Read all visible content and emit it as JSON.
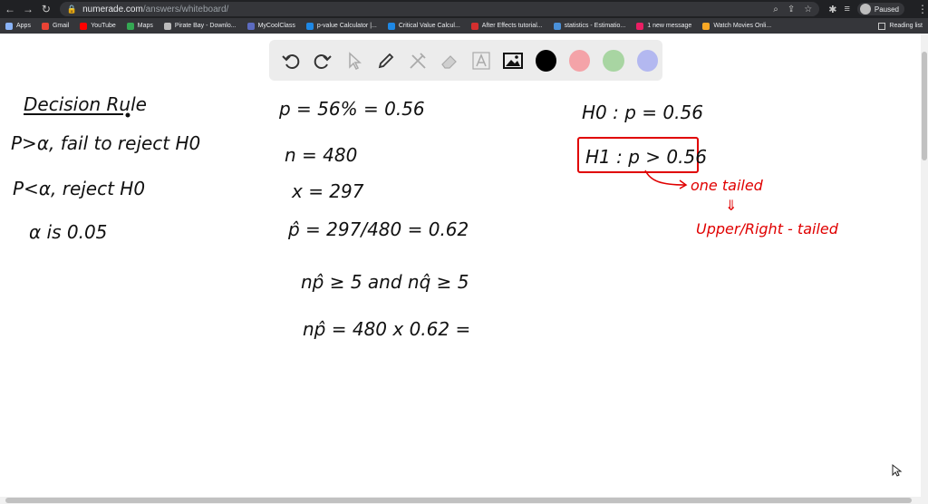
{
  "browser": {
    "url_domain": "numerade.com",
    "url_path": "/answers/whiteboard/",
    "profile_status": "Paused",
    "bookmarks": [
      {
        "label": "Apps",
        "color": "#8ab4f8"
      },
      {
        "label": "Gmail",
        "color": "#ea4335"
      },
      {
        "label": "YouTube",
        "color": "#ff0000"
      },
      {
        "label": "Maps",
        "color": "#34a853"
      },
      {
        "label": "Pirate Bay - Downlo...",
        "color": "#bbbbbb"
      },
      {
        "label": "MyCoolClass",
        "color": "#5c6bc0"
      },
      {
        "label": "p-value Calculator |...",
        "color": "#1e88e5"
      },
      {
        "label": "Critical Value Calcul...",
        "color": "#1e88e5"
      },
      {
        "label": "After Effects tutorial...",
        "color": "#d32f2f"
      },
      {
        "label": "statistics - Estimatio...",
        "color": "#4a90d9"
      },
      {
        "label": "1 new message",
        "color": "#e91e63"
      },
      {
        "label": "Watch Movies Onli...",
        "color": "#f9a825"
      }
    ],
    "reading_list": "Reading list"
  },
  "toolbar": {
    "tools": [
      "undo-icon",
      "redo-icon",
      "pointer-icon",
      "pen-icon",
      "tools-icon",
      "eraser-icon",
      "text-icon",
      "image-icon"
    ],
    "colors": [
      "#000000",
      "#f4a3a8",
      "#a8d5a2",
      "#b3b8f0"
    ]
  },
  "whiteboard": {
    "left_col": {
      "title": "Decision Rule",
      "line1": "P>α, fail to reject H0",
      "line2": "P<α, reject H0",
      "line3": "α is 0.05"
    },
    "mid_col": {
      "line1": "p = 56% = 0.56",
      "line2": "n = 480",
      "line3": "x = 297",
      "line4": "p̂ = 297/480 = 0.62",
      "line5": "np̂ ≥ 5 and nq̂ ≥ 5",
      "line6": "np̂ = 480 x 0.62 ="
    },
    "right_col": {
      "h0": "H0 : p = 0.56",
      "h1": "H1 : p > 0.56",
      "note1": "one tailed",
      "arrow": "⇓",
      "note2": "Upper/Right - tailed"
    }
  }
}
